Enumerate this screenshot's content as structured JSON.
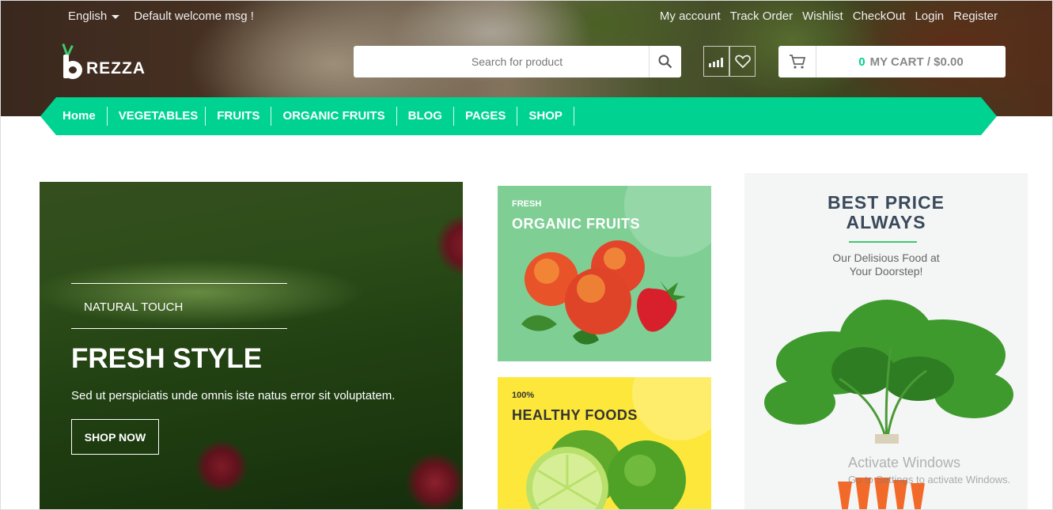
{
  "topbar": {
    "language": "English",
    "welcome": "Default welcome msg !",
    "links": [
      "My account",
      "Track Order",
      "Wishlist",
      "CheckOut",
      "Login",
      "Register"
    ]
  },
  "logo": {
    "text": "REZZA"
  },
  "search": {
    "placeholder": "Search for product"
  },
  "cart": {
    "count": "0",
    "label": "MY CART / $0.00"
  },
  "nav": {
    "items": [
      "Home",
      "VEGETABLES",
      "FRUITS",
      "ORGANIC FRUITS",
      "BLOG",
      "PAGES",
      "SHOP"
    ]
  },
  "hero": {
    "kicker": "NATURAL TOUCH",
    "title": "FRESH STYLE",
    "description": "Sed ut perspiciatis unde omnis iste natus error sit voluptatem.",
    "button": "SHOP NOW"
  },
  "banner1": {
    "small": "FRESH",
    "big": "ORGANIC FRUITS"
  },
  "banner2": {
    "small": "100%",
    "big": "HEALTHY FOODS"
  },
  "banner3": {
    "line1": "BEST PRICE",
    "line2": "ALWAYS",
    "sub1": "Our Delisious Food at",
    "sub2": "Your Doorstep!"
  },
  "watermark": {
    "line1": "Activate Windows",
    "line2": "Go to Settings to activate Windows."
  },
  "colors": {
    "accent": "#00d391",
    "banner_green": "#7fcf95",
    "banner_yellow": "#fde73a"
  },
  "icons": [
    "search-icon",
    "compare-icon",
    "heart-icon",
    "cart-icon",
    "caret-down-icon"
  ]
}
